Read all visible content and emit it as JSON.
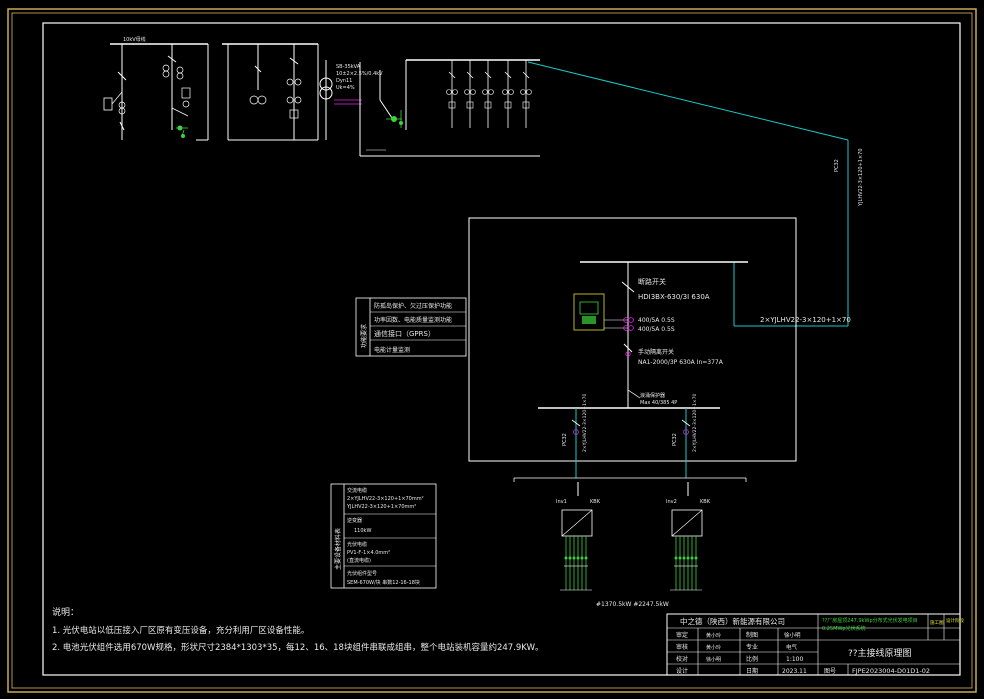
{
  "colors": {
    "frame": "#d8b75a",
    "line": "#ffffff",
    "cyan": "#19c8c8",
    "green": "#3cd23c",
    "magenta": "#e628e6",
    "yellow": "#e6e628",
    "text": "#e8e8e8"
  },
  "grid": {
    "grid_label": "10kV母线"
  },
  "transformer": {
    "lines": [
      "SB-35kVA",
      "10±2×2.5%/0.4kV",
      "Dyn11",
      "Uk=4%"
    ]
  },
  "feeder": {
    "vertical_cable": "YJLHV22-3×120+1×70",
    "vertical_tag": "PC32"
  },
  "panel": {
    "breaker_title": "断路开关",
    "breaker_spec": "HDI3BX-630/3I 630A",
    "ct1": "400/5A 0.5S",
    "ct2": "400/5A 0.5S",
    "switch_title": "手动隔离开关",
    "switch_spec": "NA1-2000/3P 630A In=377A",
    "spd_title": "浪涌保护器",
    "spd_spec": "Max 40/385 4P",
    "incoming_cable": "2×YJLHV22-3×120+1×70",
    "outgoing_tags": [
      "PC32",
      "PC32"
    ],
    "outgoing_cables": [
      "2×YJLHV22-3×120+1×70",
      "2×YJLHV22-3×120+1×70"
    ]
  },
  "functions": {
    "side_label": "功能要求",
    "items": [
      "防孤岛保护、欠过压保护功能",
      "功率因数、电能质量监测功能",
      "通信接口（GPRS）",
      "电能计量监测"
    ]
  },
  "inverters": {
    "labels": [
      "Inv1",
      "Inv2"
    ],
    "names": [
      "KBK",
      "KBK"
    ],
    "bottom_caption": "#1370.5kW  #2247.5kW"
  },
  "equipment_table": {
    "side_label": "主要设备材料表",
    "rows": [
      {
        "head": "交流电缆",
        "lines": [
          "2×YJLHV22-3×120+1×70mm²",
          "YJLHV22-3×120+1×70mm²"
        ]
      },
      {
        "head": "逆变器",
        "lines": [
          "110kW"
        ]
      },
      {
        "head": "光伏电缆",
        "lines": [
          "PV1-F-1×4.0mm²",
          "(直流电缆)"
        ]
      },
      {
        "head": "光伏组件型号",
        "lines": [
          "SEM-670W/块 串数12-16-18块"
        ]
      }
    ]
  },
  "notes": {
    "title": "说明：",
    "lines": [
      "1. 光伏电站以低压接入厂区原有变压设备，充分利用厂区设备性能。",
      "2. 电池光伏组件选用670W规格，形状尺寸2384*1303*35，每12、16、18块组件串联成组串，整个电站装机容量约247.9KW。"
    ]
  },
  "title_block": {
    "company": "中之德（陕西）新能源有限公司",
    "project": "??厂房屋顶247.9kWp分布式光伏发电项目",
    "project2": "0.25MWp光伏系统",
    "stage": "施工图",
    "stage_head": "设计阶段",
    "row_heads": [
      "审定",
      "审核",
      "校对",
      "设计"
    ],
    "row_signs": [
      "黄小玲",
      "黄小玲",
      "徐小明",
      ""
    ],
    "mid_heads": [
      "制图",
      "专业",
      "比例",
      "日期"
    ],
    "mid_vals": [
      "徐小明",
      "电气",
      "1:100",
      "2023.11"
    ],
    "col3": [
      "制图",
      "专业",
      "比例",
      "日期"
    ],
    "drawing_name": "??主接线原理图",
    "drawing_no_head": "图号",
    "drawing_no": "FJPE2023004-D01D1-02"
  }
}
